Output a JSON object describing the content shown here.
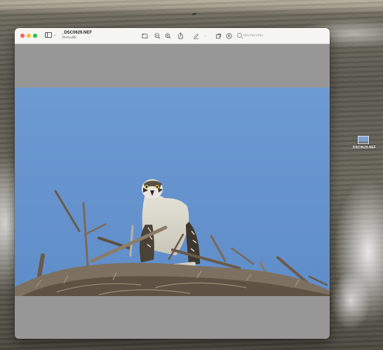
{
  "window": {
    "title": "_DSC0629.NEF",
    "subtitle": "Verrouillé"
  },
  "search": {
    "placeholder": "Rechercher"
  },
  "desktop": {
    "file_label": "_DSC0629.NEF"
  },
  "toolbar": {
    "icons": [
      "sidebar-icon",
      "rotate-icon",
      "zoom-out-icon",
      "zoom-in-icon",
      "share-icon",
      "markup-icon",
      "chevron-down-icon",
      "crop-icon",
      "info-icon",
      "search-icon"
    ]
  },
  "colors": {
    "sky": "#6d9ad2",
    "letterbox": "#979797",
    "titlebar": "#f5f5f4"
  }
}
